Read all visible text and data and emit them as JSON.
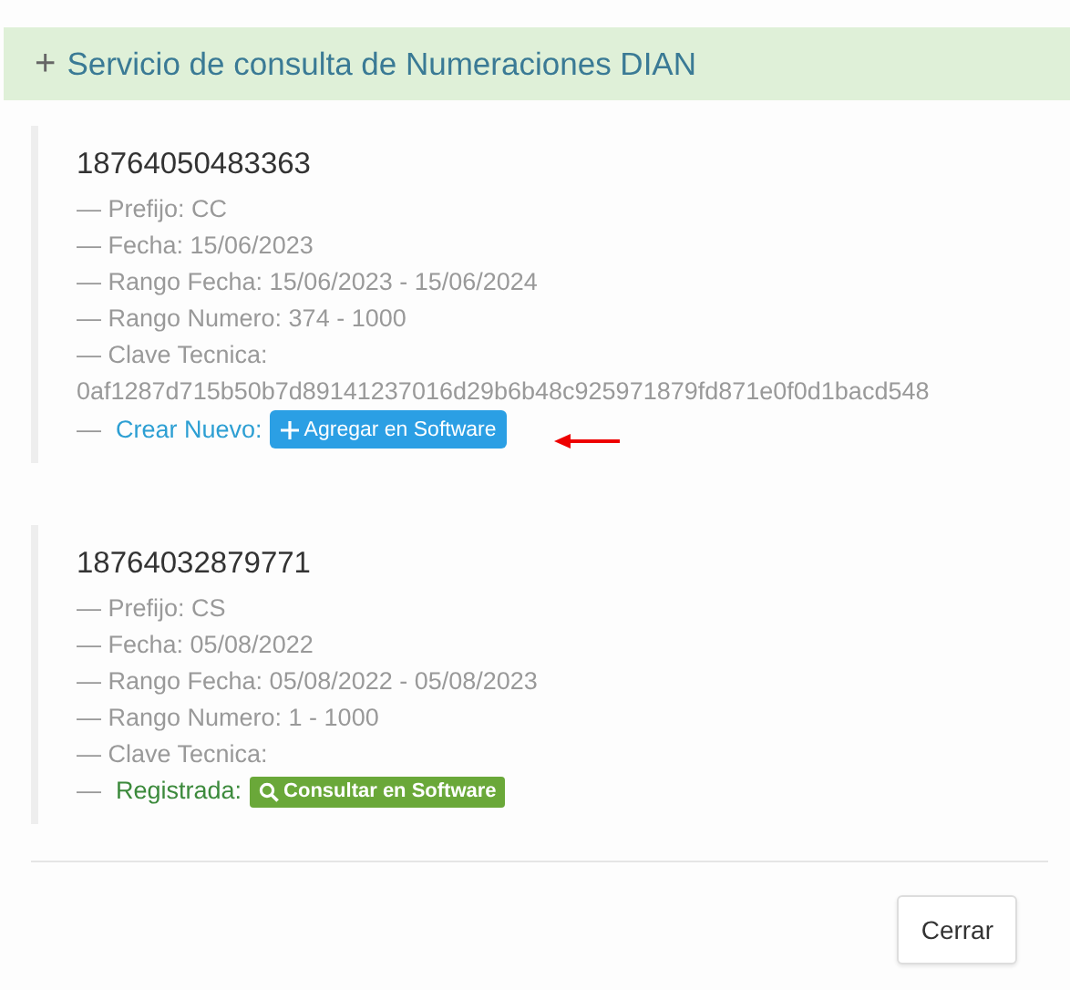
{
  "header": {
    "icon": "+",
    "title": "Servicio de consulta de Numeraciones DIAN"
  },
  "records": [
    {
      "number": "18764050483363",
      "lines": [
        "— Prefijo: CC",
        "— Fecha: 15/06/2023",
        "— Rango Fecha: 15/06/2023 - 15/06/2024",
        "— Rango Numero: 374 - 1000",
        "— Clave Tecnica: 0af1287d715b50b7d89141237016d29b6b48c925971879fd871e0f0d1bacd548"
      ],
      "action": {
        "kind": "create",
        "dash": "—",
        "label": "Crear Nuevo:",
        "button": "Agregar en Software"
      },
      "pointer_arrow": true
    },
    {
      "number": "18764032879771",
      "lines": [
        "— Prefijo: CS",
        "— Fecha: 05/08/2022",
        "— Rango Fecha: 05/08/2022 - 05/08/2023",
        "— Rango Numero: 1 - 1000",
        "— Clave Tecnica:"
      ],
      "action": {
        "kind": "registered",
        "dash": "—",
        "label": "Registrada:",
        "button": "Consultar en Software"
      },
      "pointer_arrow": false
    }
  ],
  "footer": {
    "button": "Cerrar"
  }
}
